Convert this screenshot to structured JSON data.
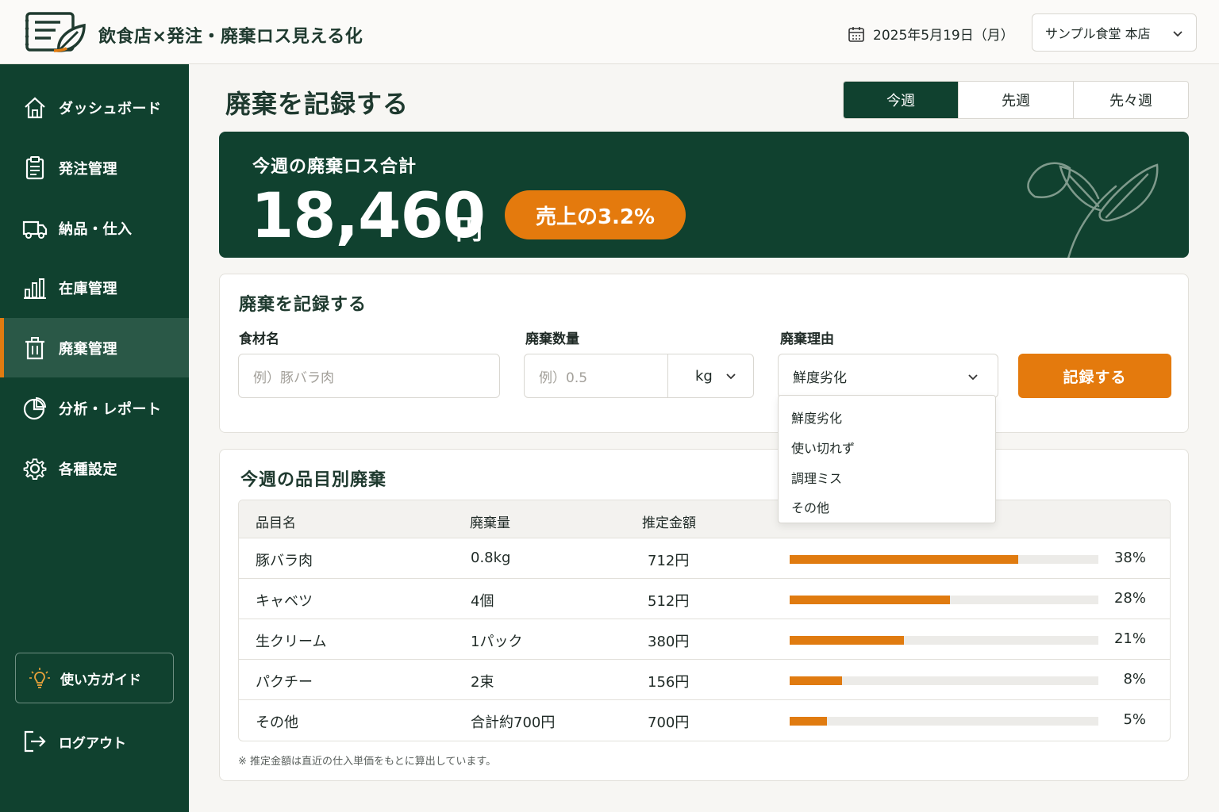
{
  "header": {
    "app_title": "飲食店×発注・廃棄ロス見える化",
    "date": "2025年5月19日（月）",
    "store": "サンプル食堂 本店"
  },
  "sidebar": {
    "items": [
      {
        "label": "ダッシュボード",
        "icon": "home-icon"
      },
      {
        "label": "発注管理",
        "icon": "clipboard-icon"
      },
      {
        "label": "納品・仕入",
        "icon": "truck-icon"
      },
      {
        "label": "在庫管理",
        "icon": "bar-chart-icon"
      },
      {
        "label": "廃棄管理",
        "icon": "trash-icon",
        "active": true
      },
      {
        "label": "分析・レポート",
        "icon": "pie-chart-icon"
      },
      {
        "label": "各種設定",
        "icon": "gear-icon"
      }
    ],
    "guide": "使い方ガイド",
    "logout": "ログアウト"
  },
  "main": {
    "title": "廃棄を記録する",
    "tabs": [
      "今週",
      "先週",
      "先々週"
    ],
    "active_tab": "今週"
  },
  "summary": {
    "label": "今週の廃棄ロス合計",
    "amount": "18,460",
    "unit": "円",
    "badge": "売上の3.2%"
  },
  "record_form": {
    "title": "廃棄を記録する",
    "ingredient_label": "食材名",
    "ingredient_placeholder": "例）豚バラ肉",
    "quantity_label": "廃棄数量",
    "quantity_placeholder": "例）0.5",
    "unit": "kg",
    "reason_label": "廃棄理由",
    "reason_value": "鮮度劣化",
    "reason_options": [
      "鮮度劣化",
      "使い切れず",
      "調理ミス",
      "その他"
    ],
    "submit": "記録する"
  },
  "waste_table": {
    "title": "今週の品目別廃棄",
    "columns": [
      "品目名",
      "廃棄量",
      "推定金額"
    ],
    "rows": [
      {
        "item": "豚バラ肉",
        "qty": "0.8kg",
        "amount": "712円",
        "pct": "38%",
        "share": 0.74
      },
      {
        "item": "キャベツ",
        "qty": "4個",
        "amount": "512円",
        "pct": "28%",
        "share": 0.52
      },
      {
        "item": "生クリーム",
        "qty": "1パック",
        "amount": "380円",
        "pct": "21%",
        "share": 0.37
      },
      {
        "item": "パクチー",
        "qty": "2束",
        "amount": "156円",
        "pct": "8%",
        "share": 0.17
      },
      {
        "item": "その他",
        "qty": "合計約700円",
        "amount": "700円",
        "pct": "5%",
        "share": 0.12
      }
    ],
    "note": "※ 推定金額は直近の仕入単価をもとに算出しています。"
  },
  "colors": {
    "primary": "#10412f",
    "accent": "#e47a0d",
    "background": "#f7f6f3"
  }
}
